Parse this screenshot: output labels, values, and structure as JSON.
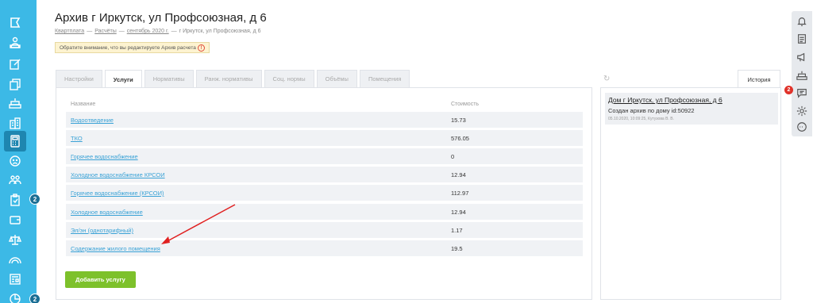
{
  "sidebar": {
    "items": [
      {
        "icon": "flag-icon"
      },
      {
        "icon": "users-icon"
      },
      {
        "icon": "edit-icon"
      },
      {
        "icon": "documents-icon"
      },
      {
        "icon": "cake-icon"
      },
      {
        "icon": "buildings-icon"
      },
      {
        "icon": "calculator-icon"
      },
      {
        "icon": "sad-face-icon"
      },
      {
        "icon": "people-icon"
      },
      {
        "icon": "clipboard-icon"
      },
      {
        "icon": "wallet-icon"
      },
      {
        "icon": "scales-icon"
      },
      {
        "icon": "rainbow-icon"
      },
      {
        "icon": "newspaper-icon"
      },
      {
        "icon": "pie-chart-icon"
      }
    ],
    "badges": [
      "2",
      "2"
    ]
  },
  "header": {
    "title": "Архив г Иркутск, ул Профсоюзная, д 6",
    "breadcrumb": [
      "Квартплата",
      "Расчёты",
      "сентябрь 2020 г.",
      "г Иркутск, ул Профсоюзная, д 6"
    ],
    "breadcrumb_sep": "—",
    "warning": "Обратите внимание, что вы редактируете Архив расчета",
    "warning_icon": "!"
  },
  "tabs": [
    {
      "label": "Настройки",
      "active": false
    },
    {
      "label": "Услуги",
      "active": true
    },
    {
      "label": "Нормативы",
      "active": false
    },
    {
      "label": "Ранж. нормативы",
      "active": false
    },
    {
      "label": "Соц. нормы",
      "active": false
    },
    {
      "label": "Объёмы",
      "active": false
    },
    {
      "label": "Помещения",
      "active": false
    }
  ],
  "table": {
    "headers": {
      "name": "Название",
      "cost": "Стоимость"
    },
    "rows": [
      {
        "name": "Водоотведение",
        "cost": "15.73"
      },
      {
        "name": "ТКО",
        "cost": "576.05"
      },
      {
        "name": "Горячее водоснабжение",
        "cost": "0"
      },
      {
        "name": "Холодное водоснабжение КРСОИ",
        "cost": "12.94"
      },
      {
        "name": "Горячее водоснабжение (КРСОИ)",
        "cost": "112.97"
      },
      {
        "name": "Холодное водоснабжение",
        "cost": "12.94"
      },
      {
        "name": "Эл/эн (однотарифный)",
        "cost": "1.17"
      },
      {
        "name": "Содержание жилого помещения",
        "cost": "19.5"
      }
    ],
    "add_button": "Добавить услугу"
  },
  "history": {
    "tab_label": "История",
    "items": [
      {
        "title": "Дом г Иркутск, ул Профсоюзная, д 6",
        "text": "Создан архив по дому id:50922",
        "meta": "05.10.2020, 10:09:25, Кутузова В. В."
      }
    ]
  },
  "right_toolbar": {
    "icons": [
      "bell-icon",
      "document-icon",
      "megaphone-icon",
      "cake-icon",
      "chat-icon",
      "settings-icon",
      "support-chat-icon"
    ],
    "badge": "2"
  },
  "colors": {
    "sidebar": "#3cb9e6",
    "link": "#3aa2d6",
    "button": "#7dc12b",
    "warning_bg": "#fdf3d0",
    "badge_red": "#e0322a",
    "arrow": "#e02020"
  }
}
